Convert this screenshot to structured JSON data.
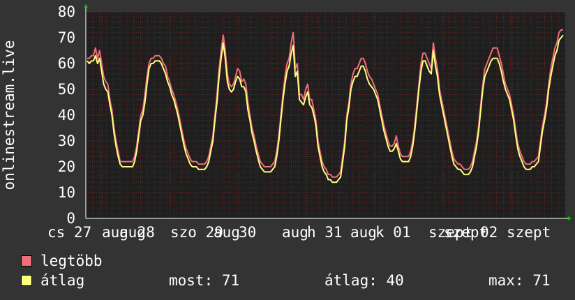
{
  "colors": {
    "background": "#333333",
    "plot_background": "#1e1e1e",
    "grid_minor": "#5a2a2a",
    "grid_major": "#7a3030",
    "text": "#ffffff",
    "max_series": "#ee6e7a",
    "avg_series": "#ffff80",
    "arrow": "#00cc00"
  },
  "legend": {
    "max_label": "legtöbb",
    "avg_label": "átlag"
  },
  "stats": {
    "now": "most: 71",
    "avg": "átlag: 40",
    "max": "max: 71"
  },
  "chart_data": {
    "type": "line",
    "ylabel": "onlinestream.live",
    "ylim": [
      0,
      80
    ],
    "y_ticks": [
      "0",
      "10",
      "20",
      "30",
      "40",
      "50",
      "60",
      "70",
      "80"
    ],
    "x_ticks": [
      "cs 27",
      "aug 28",
      "aug",
      "szo 29",
      "aug",
      "30",
      "aug",
      "h 31",
      "aug",
      "k 01",
      "szept",
      "szept",
      "02",
      "szept"
    ],
    "grid": true,
    "legend_position": "bottom-left",
    "series": [
      {
        "name": "legtöbb",
        "color": "#ee6e7a",
        "values": [
          62,
          62,
          63,
          63,
          66,
          62,
          65,
          60,
          55,
          53,
          52,
          46,
          42,
          35,
          30,
          26,
          22,
          22,
          22,
          22,
          22,
          22,
          22,
          24,
          28,
          34,
          40,
          42,
          48,
          55,
          60,
          62,
          62,
          63,
          63,
          63,
          62,
          60,
          59,
          55,
          53,
          50,
          48,
          45,
          42,
          38,
          34,
          30,
          27,
          25,
          23,
          22,
          22,
          22,
          21,
          21,
          21,
          21,
          22,
          24,
          28,
          32,
          40,
          48,
          58,
          65,
          71,
          65,
          56,
          52,
          51,
          52,
          55,
          58,
          57,
          53,
          54,
          52,
          45,
          40,
          35,
          32,
          28,
          25,
          22,
          21,
          20,
          20,
          20,
          20,
          21,
          22,
          26,
          32,
          40,
          48,
          55,
          60,
          62,
          68,
          72,
          58,
          60,
          48,
          48,
          46,
          50,
          52,
          46,
          46,
          42,
          38,
          30,
          26,
          22,
          20,
          19,
          17,
          17,
          16,
          16,
          16,
          17,
          18,
          24,
          30,
          40,
          45,
          52,
          56,
          58,
          58,
          60,
          62,
          62,
          60,
          57,
          55,
          54,
          52,
          50,
          48,
          44,
          40,
          36,
          33,
          30,
          28,
          28,
          29,
          32,
          28,
          25,
          24,
          24,
          24,
          24,
          26,
          30,
          36,
          44,
          52,
          60,
          64,
          64,
          62,
          60,
          58,
          68,
          62,
          58,
          50,
          46,
          42,
          38,
          34,
          30,
          26,
          23,
          22,
          21,
          21,
          20,
          19,
          19,
          19,
          20,
          22,
          26,
          30,
          36,
          44,
          52,
          58,
          60,
          62,
          64,
          66,
          66,
          66,
          63,
          60,
          56,
          52,
          50,
          48,
          44,
          40,
          34,
          29,
          26,
          24,
          22,
          21,
          21,
          21,
          22,
          22,
          23,
          24,
          30,
          36,
          40,
          45,
          52,
          58,
          62,
          66,
          68,
          72,
          73,
          73
        ]
      },
      {
        "name": "átlag",
        "color": "#ffff80",
        "values": [
          61,
          60,
          61,
          61,
          63,
          60,
          62,
          57,
          52,
          50,
          49,
          44,
          40,
          33,
          28,
          24,
          21,
          20,
          20,
          20,
          20,
          20,
          20,
          22,
          26,
          32,
          38,
          40,
          45,
          52,
          58,
          60,
          60,
          61,
          61,
          61,
          60,
          58,
          56,
          53,
          51,
          48,
          46,
          43,
          40,
          36,
          32,
          28,
          25,
          23,
          21,
          20,
          20,
          20,
          19,
          19,
          19,
          19,
          20,
          22,
          26,
          30,
          38,
          45,
          55,
          62,
          68,
          62,
          53,
          50,
          49,
          50,
          53,
          55,
          54,
          51,
          51,
          49,
          42,
          38,
          33,
          30,
          26,
          23,
          20,
          19,
          18,
          18,
          18,
          18,
          19,
          20,
          24,
          30,
          38,
          46,
          52,
          57,
          59,
          64,
          67,
          55,
          57,
          46,
          45,
          44,
          47,
          49,
          44,
          43,
          40,
          36,
          28,
          24,
          20,
          18,
          17,
          15,
          15,
          14,
          14,
          14,
          15,
          16,
          22,
          28,
          38,
          43,
          50,
          53,
          55,
          55,
          57,
          59,
          59,
          57,
          54,
          52,
          51,
          50,
          48,
          46,
          42,
          38,
          34,
          31,
          28,
          26,
          26,
          27,
          29,
          26,
          23,
          22,
          22,
          22,
          22,
          24,
          28,
          34,
          42,
          50,
          57,
          61,
          61,
          59,
          57,
          56,
          65,
          59,
          55,
          48,
          44,
          40,
          36,
          32,
          28,
          24,
          21,
          20,
          19,
          19,
          18,
          17,
          17,
          17,
          18,
          20,
          24,
          28,
          34,
          42,
          50,
          55,
          57,
          59,
          61,
          62,
          62,
          62,
          60,
          57,
          53,
          50,
          48,
          46,
          42,
          38,
          32,
          27,
          24,
          22,
          20,
          19,
          19,
          19,
          20,
          20,
          21,
          22,
          28,
          34,
          38,
          43,
          50,
          55,
          59,
          63,
          65,
          69,
          70,
          71
        ]
      }
    ]
  }
}
